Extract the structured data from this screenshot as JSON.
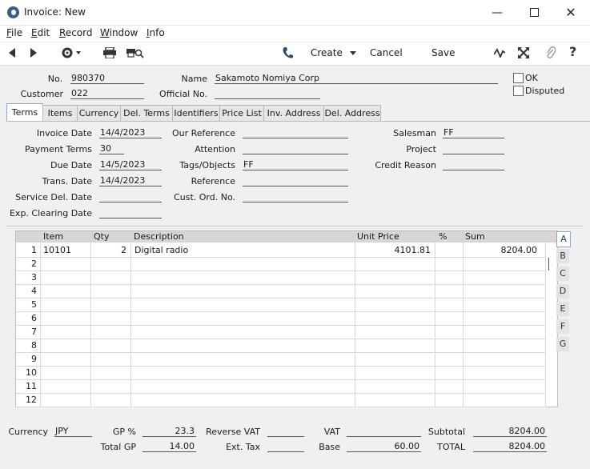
{
  "window": {
    "title": "Invoice: New"
  },
  "menu": [
    {
      "label": "File",
      "ul": "F",
      "rest": "ile"
    },
    {
      "label": "Edit",
      "ul": "E",
      "rest": "dit"
    },
    {
      "label": "Record",
      "ul": "R",
      "rest": "ecord"
    },
    {
      "label": "Window",
      "ul": "W",
      "rest": "indow"
    },
    {
      "label": "Info",
      "ul": "I",
      "rest": "nfo"
    }
  ],
  "toolbar": {
    "create_label": "Create",
    "cancel_label": "Cancel",
    "save_label": "Save"
  },
  "header": {
    "no_label": "No.",
    "no_value": "980370",
    "name_label": "Name",
    "name_value": "Sakamoto Nomiya Corp",
    "customer_label": "Customer",
    "customer_value": "022",
    "official_label": "Official No.",
    "official_value": "",
    "ok_label": "OK",
    "disputed_label": "Disputed"
  },
  "tabs": [
    "Terms",
    "Items",
    "Currency",
    "Del. Terms",
    "Identifiers",
    "Price List",
    "Inv. Address",
    "Del. Address"
  ],
  "terms": {
    "invoice_date_label": "Invoice Date",
    "invoice_date": "14/4/2023",
    "payment_terms_label": "Payment Terms",
    "payment_terms": "30",
    "due_date_label": "Due Date",
    "due_date": "14/5/2023",
    "trans_date_label": "Trans. Date",
    "trans_date": "14/4/2023",
    "service_del_label": "Service Del. Date",
    "service_del": "",
    "exp_clearing_label": "Exp. Clearing Date",
    "exp_clearing": "",
    "our_ref_label": "Our Reference",
    "our_ref": "",
    "attention_label": "Attention",
    "attention": "",
    "tags_label": "Tags/Objects",
    "tags": "FF",
    "reference_label": "Reference",
    "reference": "",
    "cust_ord_label": "Cust. Ord. No.",
    "cust_ord": "",
    "salesman_label": "Salesman",
    "salesman": "FF",
    "project_label": "Project",
    "project": "",
    "credit_reason_label": "Credit Reason",
    "credit_reason": ""
  },
  "grid": {
    "columns": [
      "Item",
      "Qty",
      "Description",
      "Unit Price",
      "%",
      "Sum"
    ],
    "rows": [
      {
        "n": "1",
        "item": "10101",
        "qty": "2",
        "desc": "Digital radio",
        "price": "4101.81",
        "pct": "",
        "sum": "8204.00"
      },
      {
        "n": "2"
      },
      {
        "n": "3"
      },
      {
        "n": "4"
      },
      {
        "n": "5"
      },
      {
        "n": "6"
      },
      {
        "n": "7"
      },
      {
        "n": "8"
      },
      {
        "n": "9"
      },
      {
        "n": "10"
      },
      {
        "n": "11"
      },
      {
        "n": "12"
      }
    ],
    "side_tabs": [
      "A",
      "B",
      "C",
      "D",
      "E",
      "F",
      "G"
    ]
  },
  "footer": {
    "currency_label": "Currency",
    "currency": "JPY",
    "gp_pct_label": "GP %",
    "gp_pct": "23.3",
    "total_gp_label": "Total GP",
    "total_gp": "14.00",
    "reverse_vat_label": "Reverse VAT",
    "reverse_vat": "",
    "ext_tax_label": "Ext. Tax",
    "ext_tax": "",
    "vat_label": "VAT",
    "vat": "",
    "base_label": "Base",
    "base": "60.00",
    "subtotal_label": "Subtotal",
    "subtotal": "8204.00",
    "total_label": "TOTAL",
    "total": "8204.00"
  }
}
